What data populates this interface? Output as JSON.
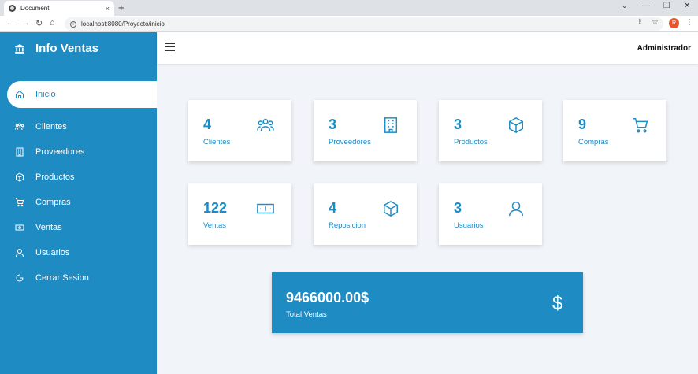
{
  "browser": {
    "tab_title": "Document",
    "tab_close": "×",
    "new_tab": "+",
    "url": "localhost:8080/Proyecto/inicio",
    "avatar_initial": "R",
    "win_min": "—",
    "win_restore": "❐",
    "win_close": "✕"
  },
  "sidebar": {
    "brand": "Info Ventas",
    "items": [
      {
        "label": "Inicio",
        "icon": "home-icon"
      },
      {
        "label": "Clientes",
        "icon": "users-icon"
      },
      {
        "label": "Proveedores",
        "icon": "building-icon"
      },
      {
        "label": "Productos",
        "icon": "box-icon"
      },
      {
        "label": "Compras",
        "icon": "cart-icon"
      },
      {
        "label": "Ventas",
        "icon": "money-icon"
      },
      {
        "label": "Usuarios",
        "icon": "user-icon"
      },
      {
        "label": "Cerrar Sesion",
        "icon": "logout-icon"
      }
    ]
  },
  "topbar": {
    "user": "Administrador"
  },
  "cards": [
    {
      "value": "4",
      "label": "Clientes",
      "icon": "users-icon"
    },
    {
      "value": "3",
      "label": "Proveedores",
      "icon": "building-icon"
    },
    {
      "value": "3",
      "label": "Productos",
      "icon": "box-icon"
    },
    {
      "value": "9",
      "label": "Compras",
      "icon": "cart-icon"
    },
    {
      "value": "122",
      "label": "Ventas",
      "icon": "money-icon"
    },
    {
      "value": "4",
      "label": "Reposicion",
      "icon": "box-icon"
    },
    {
      "value": "3",
      "label": "Usuarios",
      "icon": "user-icon"
    }
  ],
  "total": {
    "amount": "9466000.00$",
    "label": "Total Ventas",
    "symbol": "$"
  },
  "colors": {
    "accent": "#1e8bc3",
    "background": "#f1f5f9"
  }
}
